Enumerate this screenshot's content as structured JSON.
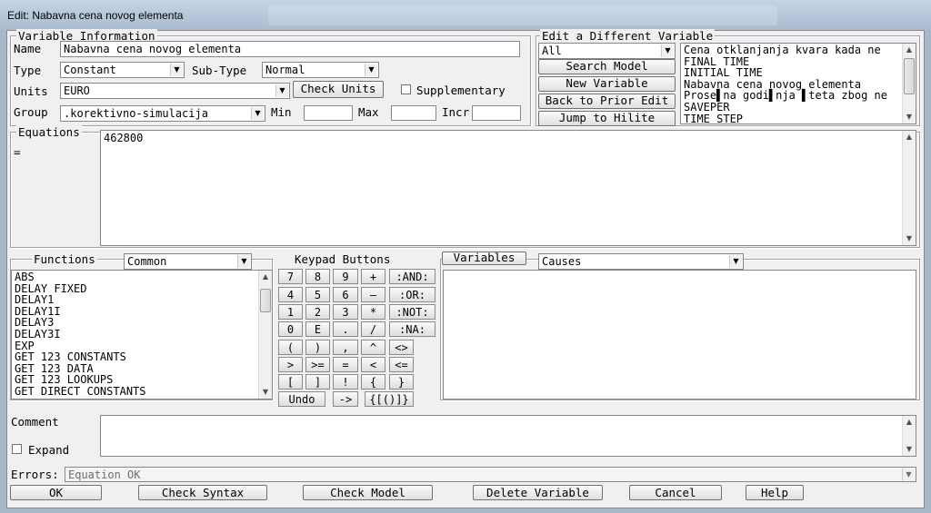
{
  "window": {
    "title": "Edit: Nabavna cena novog elementa"
  },
  "varinfo": {
    "legend": "Variable Information",
    "name_label": "Name",
    "name_value": "Nabavna cena novog elementa",
    "type_label": "Type",
    "type_value": "Constant",
    "subtype_label": "Sub-Type",
    "subtype_value": "Normal",
    "units_label": "Units",
    "units_value": "EURO",
    "check_units": "Check Units",
    "supplementary": "Supplementary",
    "group_label": "Group",
    "group_value": ".korektivno-simulacija",
    "min_label": "Min",
    "max_label": "Max",
    "incr_label": "Incr"
  },
  "editdiff": {
    "legend": "Edit a Different Variable",
    "filter": "All",
    "search_model": "Search Model",
    "new_variable": "New Variable",
    "back_prior": "Back to Prior Edit",
    "jump_hilite": "Jump to Hilite",
    "vars": [
      "Cena otklanjanja kvara kada ne",
      "FINAL TIME",
      "INITIAL TIME",
      "Nabavna cena novog elementa",
      "Prose▌na godi▌nja ▌teta zbog ne",
      "SAVEPER",
      "TIME STEP"
    ]
  },
  "equations": {
    "legend": "Equations",
    "eq_sign": "=",
    "value": "462800"
  },
  "functions": {
    "legend": "Functions",
    "category": "Common",
    "items": [
      "ABS",
      "DELAY FIXED",
      "DELAY1",
      "DELAY1I",
      "DELAY3",
      "DELAY3I",
      "EXP",
      "GET 123 CONSTANTS",
      "GET 123 DATA",
      "GET 123 LOOKUPS",
      "GET DIRECT CONSTANTS"
    ]
  },
  "keypad": {
    "legend": "Keypad Buttons",
    "rows": [
      [
        "7",
        "8",
        "9",
        "+",
        ":AND:"
      ],
      [
        "4",
        "5",
        "6",
        "–",
        ":OR:"
      ],
      [
        "1",
        "2",
        "3",
        "*",
        ":NOT:"
      ],
      [
        "0",
        "E",
        ".",
        "/",
        ":NA:"
      ],
      [
        "(",
        ")",
        ",",
        "^",
        "<>"
      ],
      [
        ">",
        ">=",
        "=",
        "<",
        "<="
      ],
      [
        "[",
        "]",
        "!",
        "{",
        "}"
      ]
    ],
    "undo": "Undo",
    "arrow": "->",
    "braces": "{[()]}"
  },
  "variables": {
    "button": "Variables",
    "mode": "Causes"
  },
  "comment": {
    "label": "Comment",
    "expand": "Expand"
  },
  "errors": {
    "label": "Errors:",
    "value": "Equation OK"
  },
  "bottom": {
    "ok": "OK",
    "check_syntax": "Check Syntax",
    "check_model": "Check Model",
    "delete_variable": "Delete Variable",
    "cancel": "Cancel",
    "help": "Help"
  }
}
